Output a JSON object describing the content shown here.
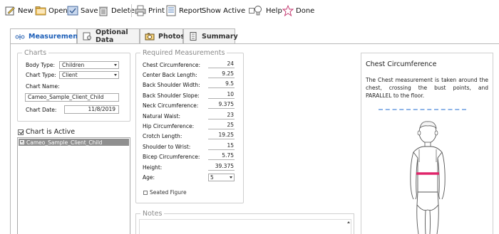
{
  "toolbar": {
    "new_label": "New",
    "open_label": "Open",
    "save_label": "Save",
    "delete_label": "Delete",
    "print_label": "Print",
    "report_label": "Report",
    "show_active_label": "Show Active",
    "help_label": "Help",
    "done_label": "Done"
  },
  "tabs": [
    {
      "label": "Measurements",
      "active": true
    },
    {
      "label": "Optional Data",
      "active": false
    },
    {
      "label": "Photos",
      "active": false
    },
    {
      "label": "Summary",
      "active": false
    }
  ],
  "charts": {
    "legend": "Charts",
    "body_type_label": "Body Type:",
    "body_type_value": "Children",
    "chart_type_label": "Chart Type:",
    "chart_type_value": "Client",
    "chart_name_label": "Chart Name:",
    "chart_name_value": "Cameo_Sample_Client_Child",
    "chart_date_label": "Chart Date:",
    "chart_date_value": "11/8/2019"
  },
  "chart_active": {
    "label": "Chart is Active",
    "checked": true,
    "items": [
      "Cameo_Sample_Client_Child"
    ]
  },
  "measurements": {
    "legend": "Required Measurements",
    "rows": [
      {
        "label": "Chest Circumference:",
        "value": "24"
      },
      {
        "label": "Center Back Length:",
        "value": "9.25"
      },
      {
        "label": "Back Shoulder Width:",
        "value": "9.5"
      },
      {
        "label": "Back Shoulder Slope:",
        "value": "10"
      },
      {
        "label": "Neck Circumference:",
        "value": "9.375"
      },
      {
        "label": "Natural Waist:",
        "value": "23"
      },
      {
        "label": "Hip Circumference:",
        "value": "25"
      },
      {
        "label": "Crotch Length:",
        "value": "19.25"
      },
      {
        "label": "Shoulder to Wrist:",
        "value": "15"
      },
      {
        "label": "Bicep Circumference:",
        "value": "5.75"
      },
      {
        "label": "Height:",
        "value": "39.375"
      }
    ],
    "age_label": "Age:",
    "age_value": "5",
    "seated_label": "Seated Figure"
  },
  "notes": {
    "legend": "Notes"
  },
  "info": {
    "title": "Chest Circumference",
    "description": "The Chest measurement is taken around the chest, crossing the bust points, and PARALLEL to the floor."
  },
  "colors": {
    "accent": "#1d5fb8",
    "measure_band": "#e0266b",
    "dash": "#8fb5e8",
    "list_selected": "#8f8f8f"
  }
}
